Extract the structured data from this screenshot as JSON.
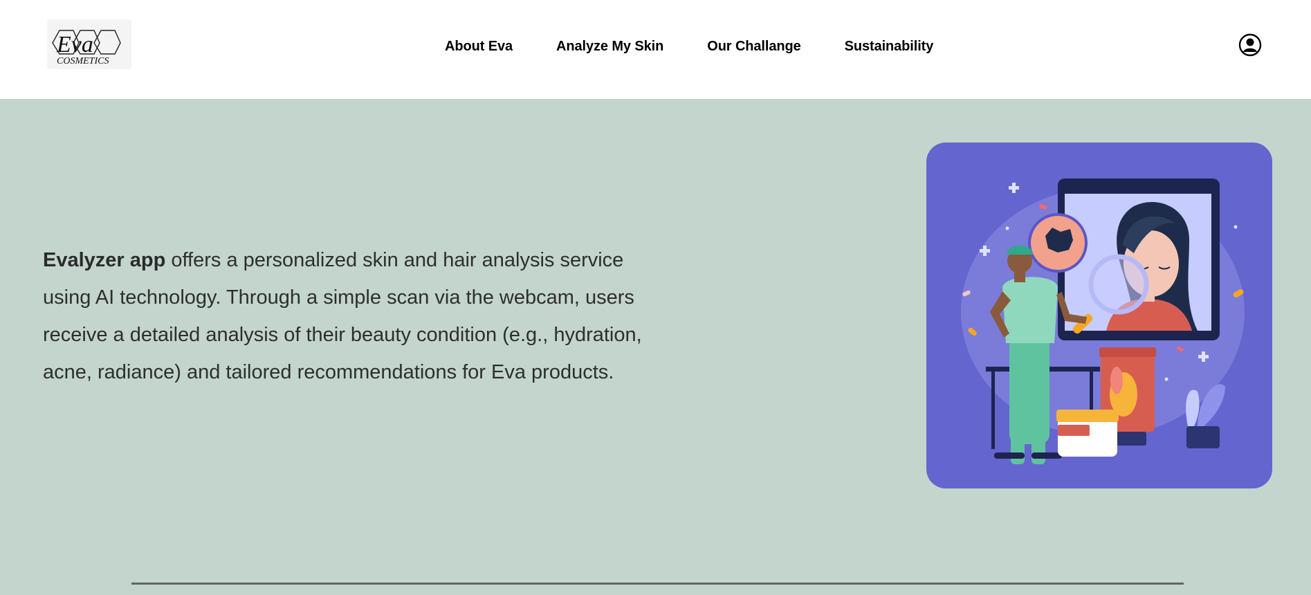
{
  "header": {
    "logo": {
      "brand": "Eva",
      "subtitle": "COSMETICS"
    },
    "nav": [
      {
        "label": "About Eva"
      },
      {
        "label": "Analyze My Skin"
      },
      {
        "label": "Our Challange"
      },
      {
        "label": "Sustainability"
      }
    ],
    "account_icon": "user-circle-icon"
  },
  "hero": {
    "app_name": "Evalyzer app",
    "description": " offers a personalized skin and hair analysis service using AI technology. Through a simple scan via the webcam, users receive a detailed analysis of their beauty condition (e.g., hydration, acne, radiance) and tailored recommendations for Eva products.",
    "illustration": "skin-analysis-illustration"
  },
  "colors": {
    "page_bg": "#c3d5cd",
    "header_bg": "#ffffff",
    "card_bg": "#6465cf",
    "text": "#2e2e2e"
  }
}
